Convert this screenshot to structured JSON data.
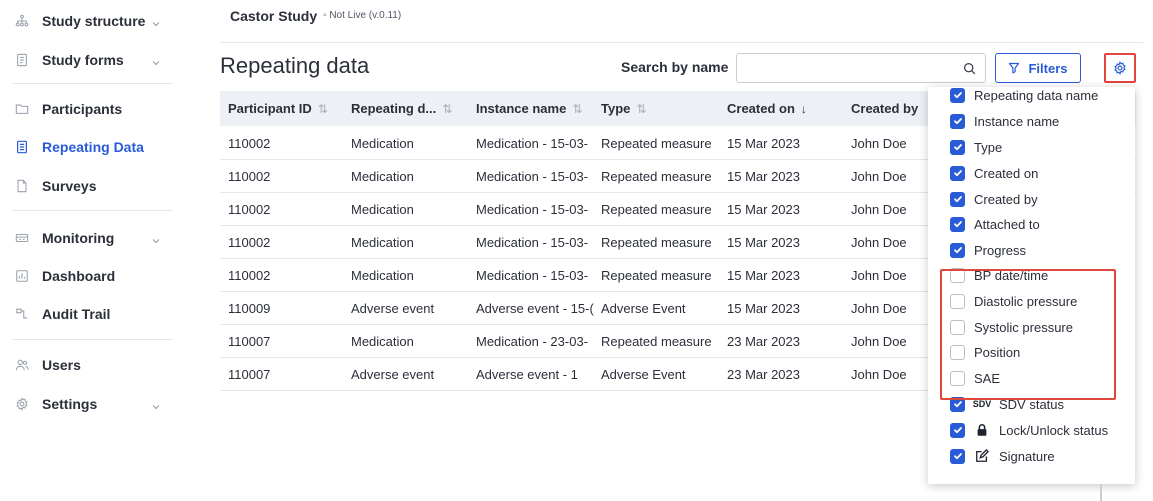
{
  "sidebar": {
    "items": [
      {
        "label": "Study structure",
        "icon": "tree-icon",
        "chevron": true
      },
      {
        "label": "Study forms",
        "icon": "form-icon",
        "chevron": true
      },
      {
        "label": "Participants",
        "icon": "folder-icon",
        "chevron": false
      },
      {
        "label": "Repeating Data",
        "icon": "repeat-form-icon",
        "chevron": false,
        "active": true
      },
      {
        "label": "Surveys",
        "icon": "survey-icon",
        "chevron": false
      },
      {
        "label": "Monitoring",
        "icon": "monitoring-icon",
        "chevron": true
      },
      {
        "label": "Dashboard",
        "icon": "dashboard-icon",
        "chevron": false
      },
      {
        "label": "Audit Trail",
        "icon": "audit-trail-icon",
        "chevron": false
      },
      {
        "label": "Users",
        "icon": "users-icon",
        "chevron": false
      },
      {
        "label": "Settings",
        "icon": "settings-gear-icon",
        "chevron": true
      }
    ]
  },
  "header": {
    "study_name": "Castor Study",
    "status": "◦ Not Live (v.0.11)"
  },
  "page": {
    "title": "Repeating data",
    "search_label": "Search by name",
    "search_value": "",
    "filters_label": "Filters"
  },
  "table": {
    "columns": [
      {
        "label": "Participant ID",
        "sort": "⇅"
      },
      {
        "label": "Repeating d...",
        "sort": "⇅"
      },
      {
        "label": "Instance name",
        "sort": "⇅"
      },
      {
        "label": "Type",
        "sort": "⇅"
      },
      {
        "label": "Created on",
        "sort": "↓"
      },
      {
        "label": "Created by",
        "sort": ""
      }
    ],
    "rows": [
      [
        "110002",
        "Medication",
        "Medication - 15-03-",
        "Repeated measure",
        "15 Mar 2023",
        "John Doe"
      ],
      [
        "110002",
        "Medication",
        "Medication - 15-03-",
        "Repeated measure",
        "15 Mar 2023",
        "John Doe"
      ],
      [
        "110002",
        "Medication",
        "Medication - 15-03-",
        "Repeated measure",
        "15 Mar 2023",
        "John Doe"
      ],
      [
        "110002",
        "Medication",
        "Medication - 15-03-",
        "Repeated measure",
        "15 Mar 2023",
        "John Doe"
      ],
      [
        "110002",
        "Medication",
        "Medication - 15-03-",
        "Repeated measure",
        "15 Mar 2023",
        "John Doe"
      ],
      [
        "110009",
        "Adverse event",
        "Adverse event - 15-(",
        "Adverse Event",
        "15 Mar 2023",
        "John Doe"
      ],
      [
        "110007",
        "Medication",
        "Medication - 23-03-",
        "Repeated measure",
        "23 Mar 2023",
        "John Doe"
      ],
      [
        "110007",
        "Adverse event",
        "Adverse event - 1",
        "Adverse Event",
        "23 Mar 2023",
        "John Doe"
      ]
    ]
  },
  "column_options": [
    {
      "label": "Repeating data name",
      "checked": true
    },
    {
      "label": "Instance name",
      "checked": true
    },
    {
      "label": "Type",
      "checked": true
    },
    {
      "label": "Created on",
      "checked": true
    },
    {
      "label": "Created by",
      "checked": true
    },
    {
      "label": "Attached to",
      "checked": true
    },
    {
      "label": "Progress",
      "checked": true
    },
    {
      "label": "BP date/time",
      "checked": false
    },
    {
      "label": "Diastolic pressure",
      "checked": false
    },
    {
      "label": "Systolic pressure",
      "checked": false
    },
    {
      "label": "Position",
      "checked": false
    },
    {
      "label": "SAE",
      "checked": false
    },
    {
      "label": "SDV status",
      "checked": true,
      "icon": "sdv-icon",
      "icon_text": "SDV"
    },
    {
      "label": "Lock/Unlock status",
      "checked": true,
      "icon": "lock-icon"
    },
    {
      "label": "Signature",
      "checked": true,
      "icon": "signature-icon"
    }
  ],
  "colors": {
    "accent": "#2a5bd7",
    "highlight": "#e0473a",
    "header_bg": "#edf0f4"
  }
}
